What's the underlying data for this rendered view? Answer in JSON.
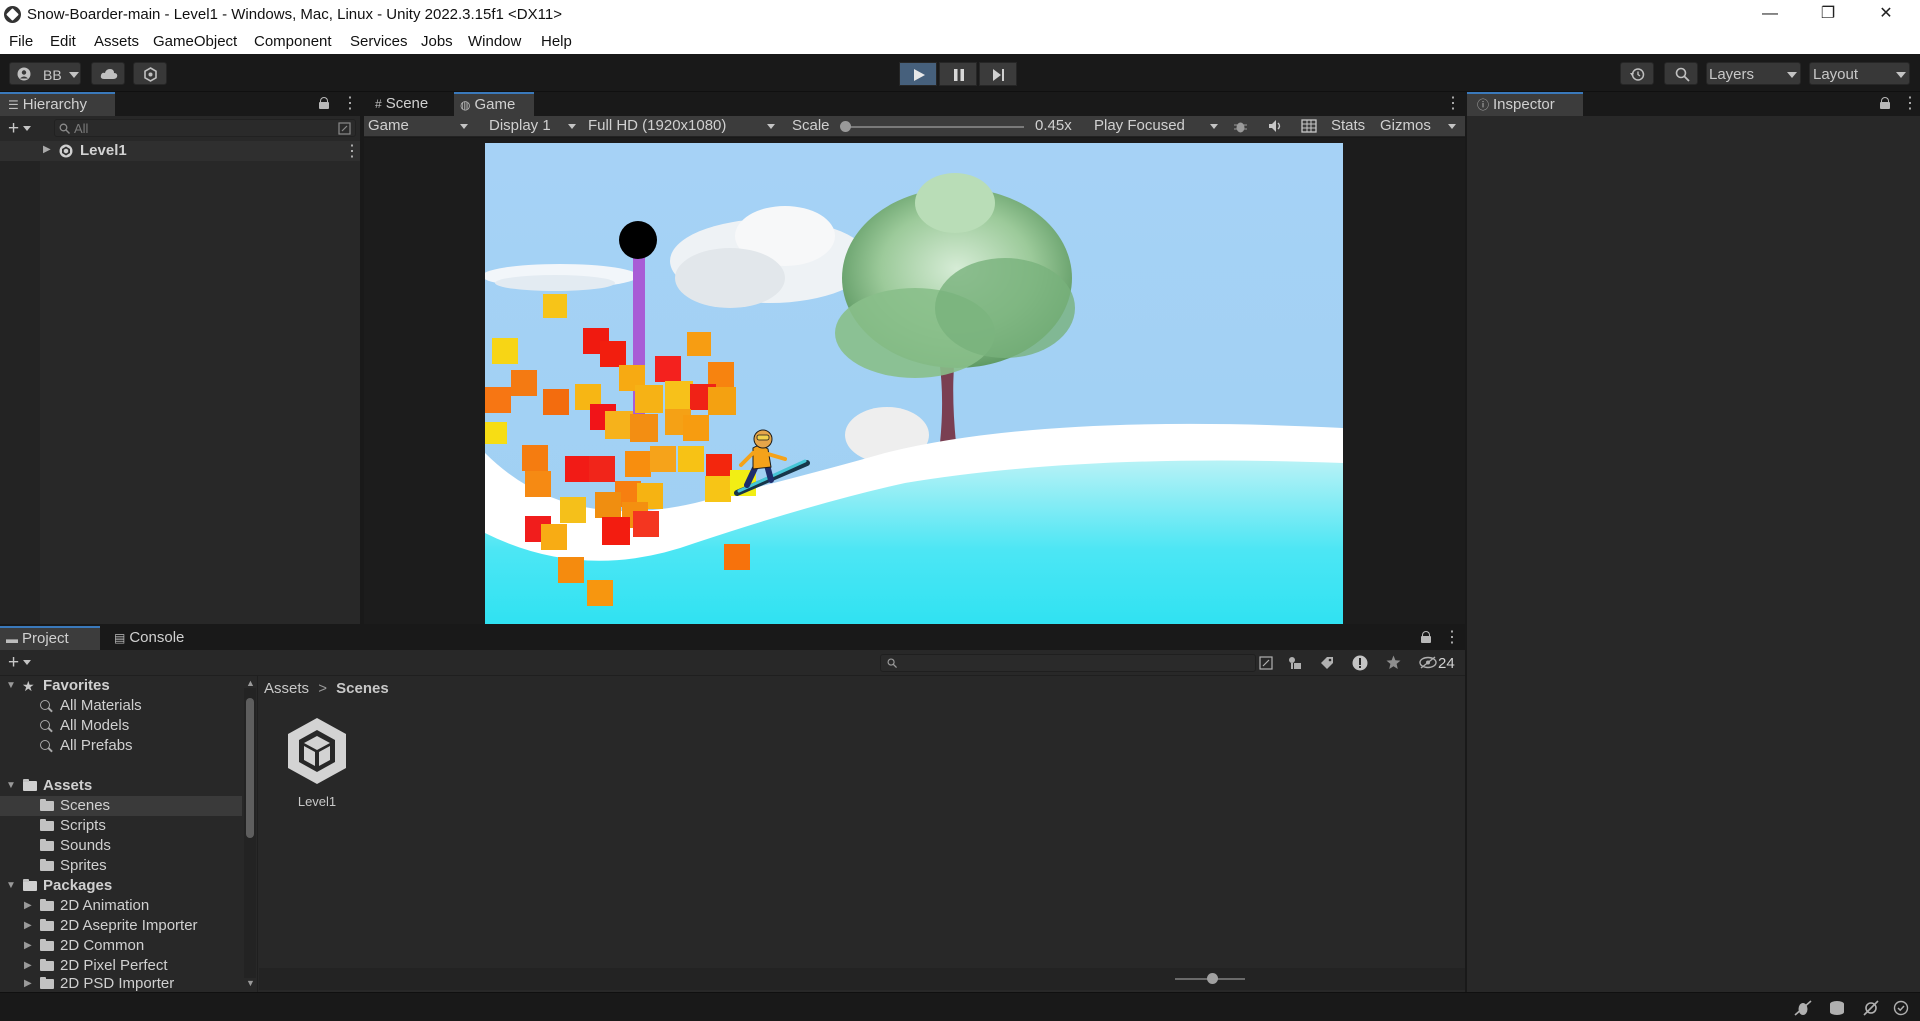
{
  "window": {
    "title": "Snow-Boarder-main - Level1 - Windows, Mac, Linux - Unity 2022.3.15f1 <DX11>",
    "controls": {
      "minimize": "—",
      "restore": "❐",
      "close": "✕"
    }
  },
  "menu": [
    "File",
    "Edit",
    "Assets",
    "GameObject",
    "Component",
    "Services",
    "Jobs",
    "Window",
    "Help"
  ],
  "toolbar": {
    "account_label": "BB",
    "play_icon": "play-icon",
    "pause_icon": "pause-icon",
    "step_icon": "step-icon",
    "layers_label": "Layers",
    "layout_label": "Layout"
  },
  "hierarchy": {
    "tab_label": "Hierarchy",
    "search_placeholder": "All",
    "root_item": "Level1"
  },
  "scene_tabs": {
    "scene_label": "Scene",
    "game_label": "Game"
  },
  "game_toolbar": {
    "view_mode": "Game",
    "display": "Display 1",
    "resolution": "Full HD (1920x1080)",
    "scale_label": "Scale",
    "scale_value": "0.45x",
    "play_mode": "Play Focused",
    "stats_label": "Stats",
    "gizmos_label": "Gizmos"
  },
  "inspector": {
    "tab_label": "Inspector"
  },
  "project": {
    "project_tab": "Project",
    "console_tab": "Console",
    "hidden_count": "24",
    "favorites_label": "Favorites",
    "favorites": [
      "All Materials",
      "All Models",
      "All Prefabs"
    ],
    "assets_label": "Assets",
    "asset_folders": [
      "Scenes",
      "Scripts",
      "Sounds",
      "Sprites"
    ],
    "packages_label": "Packages",
    "packages": [
      "2D Animation",
      "2D Aseprite Importer",
      "2D Common",
      "2D Pixel Perfect",
      "2D PSD Importer"
    ],
    "breadcrumb_root": "Assets",
    "breadcrumb_sep": ">",
    "breadcrumb_current": "Scenes",
    "asset_name": "Level1"
  },
  "colors": {
    "accent": "#3a79bb",
    "sky_top": "#a4d0f5",
    "snow": "#ffffff",
    "ice": "#36e0f0"
  }
}
